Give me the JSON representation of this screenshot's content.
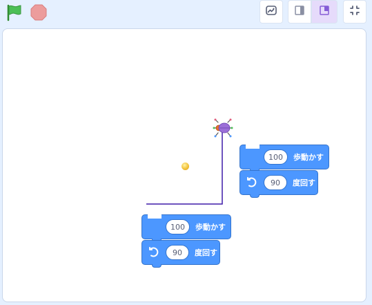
{
  "toolbar": {
    "green_flag_icon": "green-flag-icon",
    "stop_icon": "stop-icon",
    "buttons": [
      {
        "name": "screenshot-icon"
      },
      {
        "name": "small-stage-icon"
      },
      {
        "name": "normal-stage-icon"
      },
      {
        "name": "fullscreen-icon"
      }
    ]
  },
  "stage": {
    "sprite": "ladybug-sprite",
    "dot_color": "#f2c23a",
    "pen_color": "#3d1aa8"
  },
  "blocks": {
    "stack_a": {
      "move_value": "100",
      "move_label": "歩動かす",
      "turn_value": "90",
      "turn_label": "度回す"
    },
    "stack_b": {
      "move_value": "100",
      "move_label": "歩動かす",
      "turn_value": "90",
      "turn_label": "度回す"
    }
  },
  "colors": {
    "motion_block": "#4c97ff",
    "motion_border": "#3373cc",
    "stage_bg": "#ffffff",
    "page_bg": "#e5f0ff",
    "active_layout": "#e6dbfb"
  }
}
